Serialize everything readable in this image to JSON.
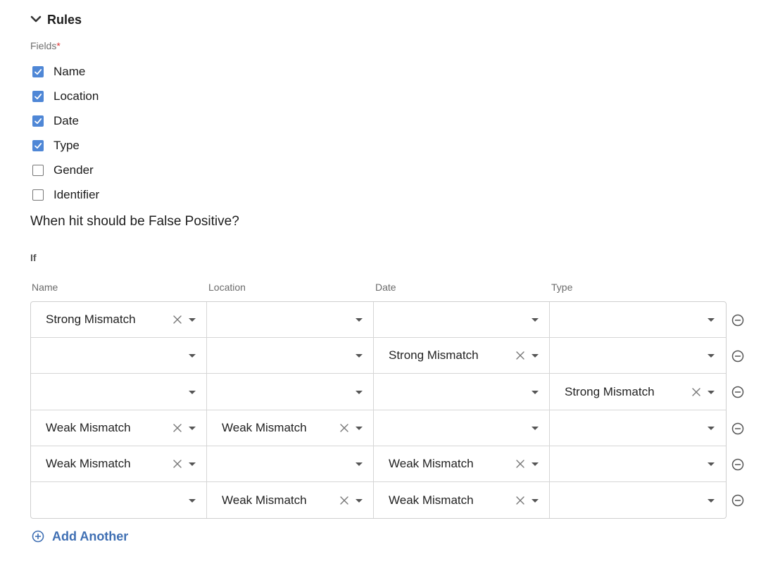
{
  "section": {
    "title": "Rules",
    "icon": "chevron-down-icon"
  },
  "fields": {
    "label": "Fields",
    "required_mark": "*",
    "items": [
      {
        "label": "Name",
        "checked": true
      },
      {
        "label": "Location",
        "checked": true
      },
      {
        "label": "Date",
        "checked": true
      },
      {
        "label": "Type",
        "checked": true
      },
      {
        "label": "Gender",
        "checked": false
      },
      {
        "label": "Identifier",
        "checked": false
      }
    ]
  },
  "question": "When hit should be False Positive?",
  "if_label": "If",
  "columns": [
    "Name",
    "Location",
    "Date",
    "Type"
  ],
  "rows": [
    [
      "Strong Mismatch",
      "",
      "",
      ""
    ],
    [
      "",
      "",
      "Strong Mismatch",
      ""
    ],
    [
      "",
      "",
      "",
      "Strong Mismatch"
    ],
    [
      "Weak Mismatch",
      "Weak Mismatch",
      "",
      ""
    ],
    [
      "Weak Mismatch",
      "",
      "Weak Mismatch",
      ""
    ],
    [
      "",
      "Weak Mismatch",
      "Weak Mismatch",
      ""
    ]
  ],
  "add_another": "Add Another",
  "colors": {
    "accent": "#4f87d6",
    "link": "#3f6fb3",
    "border": "#d6d6d6"
  }
}
